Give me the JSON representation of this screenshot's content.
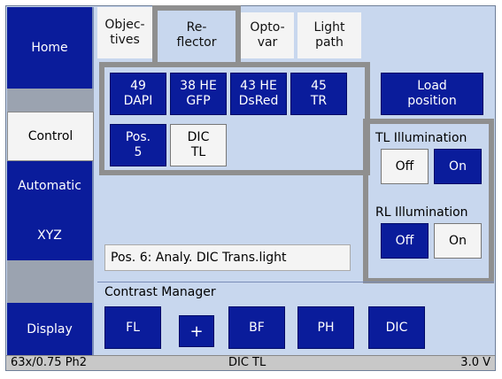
{
  "nav": {
    "home": "Home",
    "control": "Control",
    "automatic": "Automatic",
    "xyz": "XYZ",
    "display": "Display"
  },
  "tabs": [
    {
      "line1": "Objec-",
      "line2": "tives"
    },
    {
      "line1": "Re-",
      "line2": "flector"
    },
    {
      "line1": "Opto-",
      "line2": "var"
    },
    {
      "line1": "Light",
      "line2": "path"
    }
  ],
  "reflector": [
    {
      "line1": "49",
      "line2": "DAPI"
    },
    {
      "line1": "38 HE",
      "line2": "GFP"
    },
    {
      "line1": "43 HE",
      "line2": "DsRed"
    },
    {
      "line1": "45",
      "line2": "TR"
    },
    {
      "line1": "Pos.",
      "line2": "5"
    },
    {
      "line1": "DIC",
      "line2": "TL"
    }
  ],
  "load_position": {
    "line1": "Load",
    "line2": "position"
  },
  "tl_illumination": {
    "title": "TL Illumination",
    "off": "Off",
    "on": "On"
  },
  "rl_illumination": {
    "title": "RL Illumination",
    "off": "Off",
    "on": "On"
  },
  "position_info": "Pos. 6: Analy. DIC Trans.light",
  "contrast_manager": {
    "title": "Contrast Manager",
    "buttons": {
      "fl": "FL",
      "plus": "+",
      "bf": "BF",
      "ph": "PH",
      "dic": "DIC"
    }
  },
  "status": {
    "objective": "63x/0.75 Ph2",
    "mode": "DIC TL",
    "voltage": "3.0 V"
  }
}
